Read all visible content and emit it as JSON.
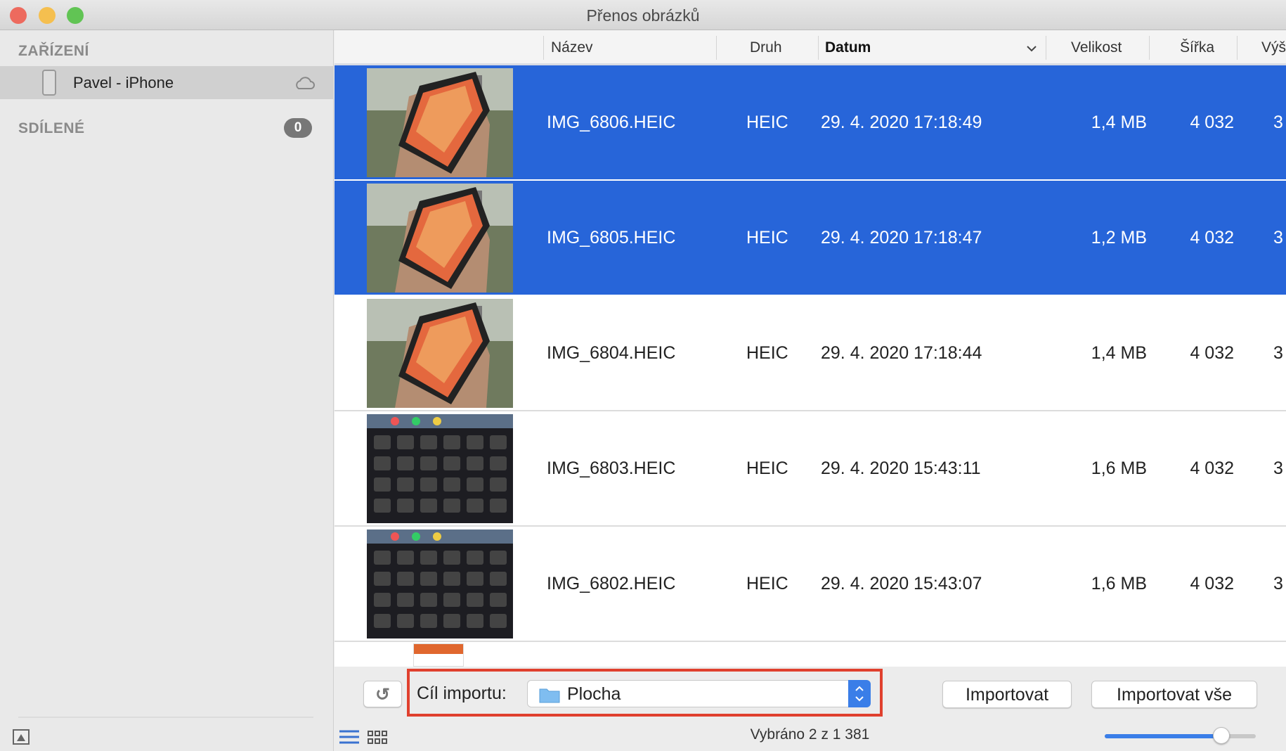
{
  "window": {
    "title": "Přenos obrázků"
  },
  "sidebar": {
    "devices_heading": "ZAŘÍZENÍ",
    "device_name": "Pavel - iPhone",
    "shared_heading": "SDÍLENÉ",
    "shared_count": "0"
  },
  "columns": {
    "name": "Název",
    "kind": "Druh",
    "date": "Datum",
    "size": "Velikost",
    "width": "Šířka",
    "height": "Výš"
  },
  "rows": [
    {
      "name": "IMG_6806.HEIC",
      "kind": "HEIC",
      "date": "29. 4. 2020 17:18:49",
      "size": "1,4 MB",
      "width": "4 032",
      "height": "3",
      "selected": true,
      "thumb": "phone"
    },
    {
      "name": "IMG_6805.HEIC",
      "kind": "HEIC",
      "date": "29. 4. 2020 17:18:47",
      "size": "1,2 MB",
      "width": "4 032",
      "height": "3",
      "selected": true,
      "thumb": "phone"
    },
    {
      "name": "IMG_6804.HEIC",
      "kind": "HEIC",
      "date": "29. 4. 2020 17:18:44",
      "size": "1,4 MB",
      "width": "4 032",
      "height": "3",
      "selected": false,
      "thumb": "phone"
    },
    {
      "name": "IMG_6803.HEIC",
      "kind": "HEIC",
      "date": "29. 4. 2020 15:43:11",
      "size": "1,6 MB",
      "width": "4 032",
      "height": "3",
      "selected": false,
      "thumb": "keyboard"
    },
    {
      "name": "IMG_6802.HEIC",
      "kind": "HEIC",
      "date": "29. 4. 2020 15:43:07",
      "size": "1,6 MB",
      "width": "4 032",
      "height": "3",
      "selected": false,
      "thumb": "keyboard"
    }
  ],
  "toolbar": {
    "import_to_label": "Cíl importu:",
    "destination": "Plocha",
    "import_label": "Importovat",
    "import_all_label": "Importovat vše"
  },
  "status": {
    "text": "Vybráno 2 z 1 381",
    "thumb_size": 0.77
  },
  "colors": {
    "selection": "#2765d9",
    "highlight_box": "#e0402e"
  }
}
